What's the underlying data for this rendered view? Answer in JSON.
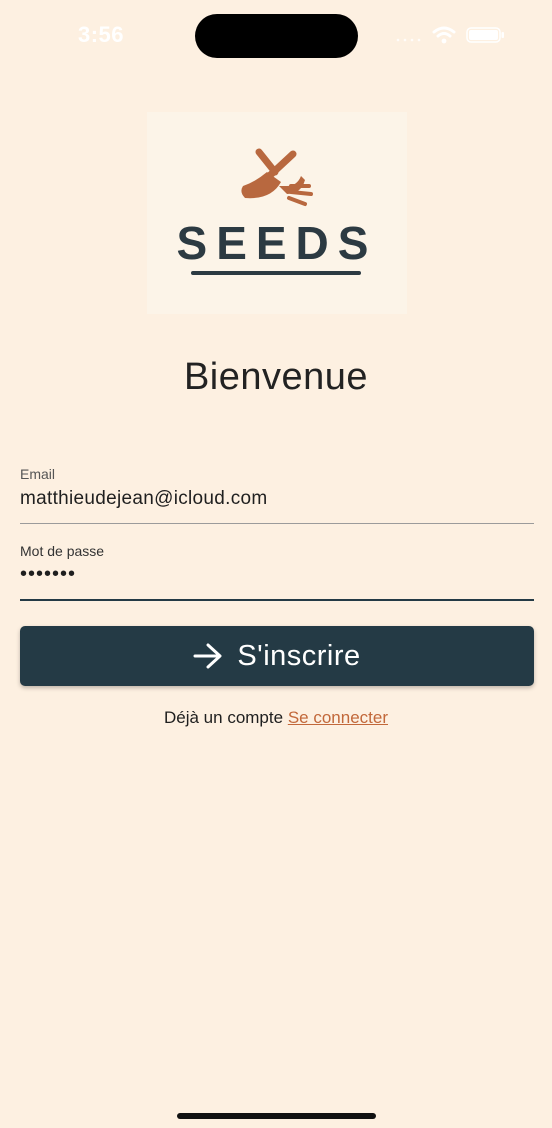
{
  "status_bar": {
    "time": "3:56",
    "icons": [
      "signal-icon",
      "wifi-icon",
      "battery-icon"
    ]
  },
  "logo": {
    "text": "SEEDS",
    "icon": "trowel-fork-icon"
  },
  "welcome_title": "Bienvenue",
  "form": {
    "email": {
      "label": "Email",
      "value": "matthieudejean@icloud.com"
    },
    "password": {
      "label": "Mot de passe",
      "value": "•••••••"
    }
  },
  "signup_button": {
    "label": "S'inscrire",
    "icon": "arrow-right-icon"
  },
  "footer": {
    "prompt": "Déjà un compte",
    "link": "Se connecter"
  },
  "colors": {
    "background": "#fdf0e1",
    "primary": "#243a45",
    "accent": "#c2683a",
    "logo_tool": "#b8683f"
  }
}
